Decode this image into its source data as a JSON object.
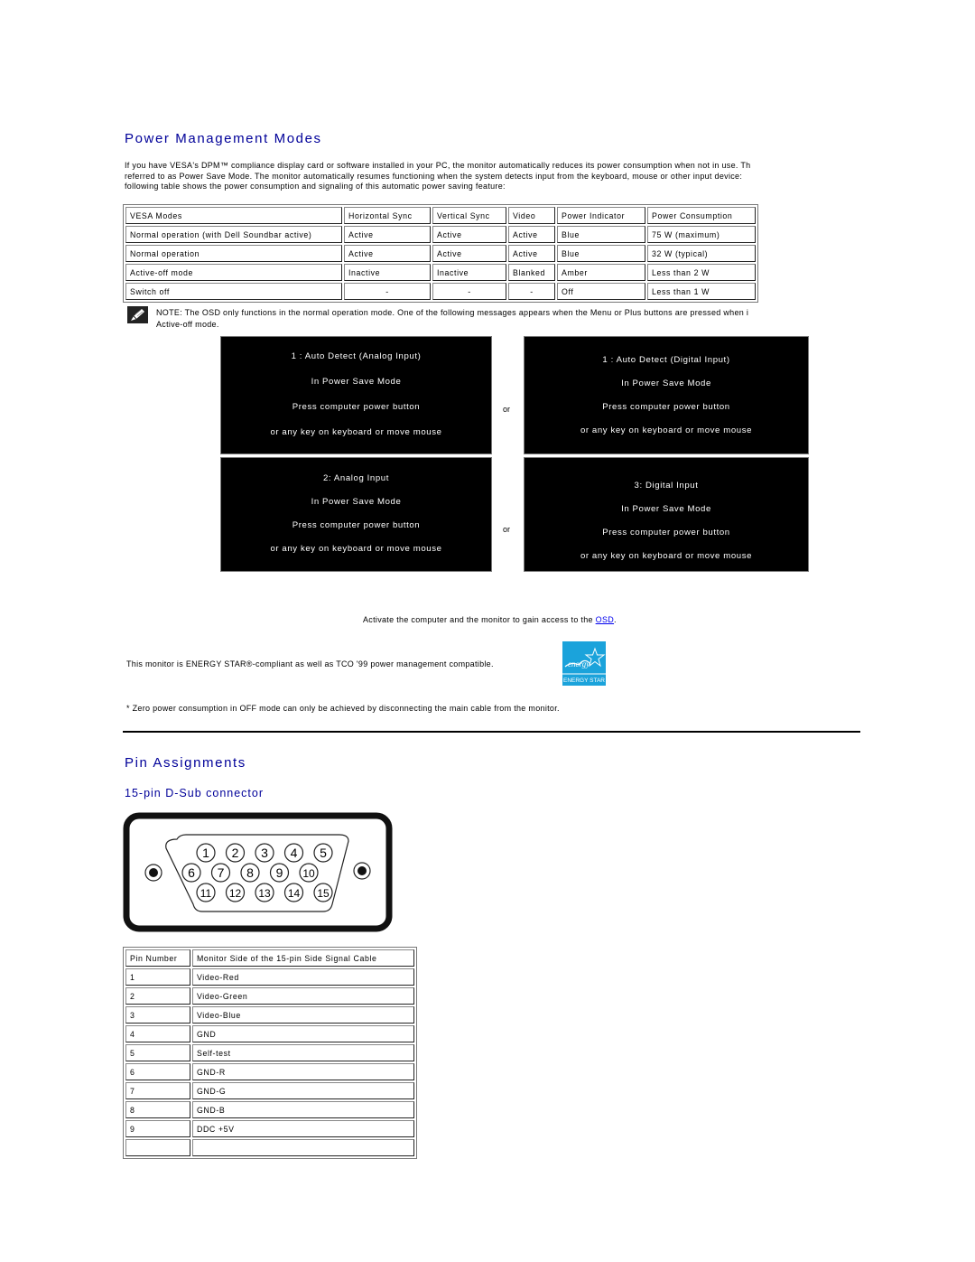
{
  "power_section": {
    "title": "Power Management Modes",
    "intro_lines": [
      "If you have VESA's DPM™ compliance display card or software installed in your PC, the monitor automatically reduces its power consumption when not in use. Th",
      "referred to as Power Save Mode. The monitor automatically resumes functioning when the system detects input from the keyboard, mouse or other input device:",
      "following table shows the power consumption and signaling of this automatic power saving feature:"
    ],
    "table": {
      "headers": [
        "VESA Modes",
        "Horizontal Sync",
        "Vertical Sync",
        "Video",
        "Power Indicator",
        "Power Consumption"
      ],
      "rows": [
        [
          "Normal operation (with Dell Soundbar active)",
          "Active",
          "Active",
          "Active",
          "Blue",
          "75 W (maximum)"
        ],
        [
          "Normal operation",
          "Active",
          "Active",
          "Active",
          "Blue",
          "32 W (typical)"
        ],
        [
          "Active-off mode",
          "Inactive",
          "Inactive",
          "Blanked",
          "Amber",
          "Less than 2 W"
        ],
        [
          "Switch off",
          "-",
          "-",
          "-",
          "Off",
          "Less than 1 W"
        ]
      ]
    },
    "note": {
      "icon": "note-pencil-icon",
      "line1": "NOTE: The OSD only functions in the normal operation mode. One of the following messages appears when the Menu or Plus buttons are pressed when i",
      "line2": "Active-off mode."
    },
    "osd_messages": [
      {
        "lines": [
          "1 : Auto Detect (Analog Input)",
          "In Power Save Mode",
          "Press computer power button",
          "or any key on keyboard or move mouse"
        ]
      },
      {
        "lines": [
          "1 : Auto Detect (Digital Input)",
          "In Power Save Mode",
          "Press computer power button",
          "or any key on keyboard or move mouse"
        ]
      },
      {
        "lines": [
          "2: Analog Input",
          "In Power Save Mode",
          "Press computer power button",
          "or any key on keyboard or move mouse"
        ]
      },
      {
        "lines": [
          "3: Digital Input",
          "In Power Save Mode",
          "Press computer power button",
          "or any key on keyboard or move mouse"
        ]
      }
    ],
    "or_label": "or",
    "activate_text": "Activate the computer and the monitor to gain access to the ",
    "activate_link": "OSD",
    "activate_suffix": ".",
    "energy_text": "This monitor is ENERGY STAR®-compliant as well as TCO '99 power management compatible.",
    "energy_logo_label": "ENERGY STAR",
    "energy_logo_script": "energy",
    "footnote": "*  Zero power consumption in OFF mode can only be achieved by disconnecting the main cable from the monitor."
  },
  "pin_section": {
    "title": "Pin Assignments",
    "subtitle": "15-pin D-Sub connector",
    "connector_pins": [
      "1",
      "2",
      "3",
      "4",
      "5",
      "6",
      "7",
      "8",
      "9",
      "10",
      "11",
      "12",
      "13",
      "14",
      "15"
    ],
    "table": {
      "headers": [
        "Pin Number",
        "Monitor Side of the 15-pin Side Signal Cable"
      ],
      "rows": [
        [
          "1",
          "Video-Red"
        ],
        [
          "2",
          "Video-Green"
        ],
        [
          "3",
          "Video-Blue"
        ],
        [
          "4",
          "GND"
        ],
        [
          "5",
          "Self-test"
        ],
        [
          "6",
          "GND-R"
        ],
        [
          "7",
          "GND-G"
        ],
        [
          "8",
          "GND-B"
        ],
        [
          "9",
          "DDC +5V"
        ],
        [
          "",
          ""
        ]
      ]
    }
  },
  "colors": {
    "heading": "#000099",
    "link": "#0000ee",
    "energy_star": "#1ba3db"
  }
}
